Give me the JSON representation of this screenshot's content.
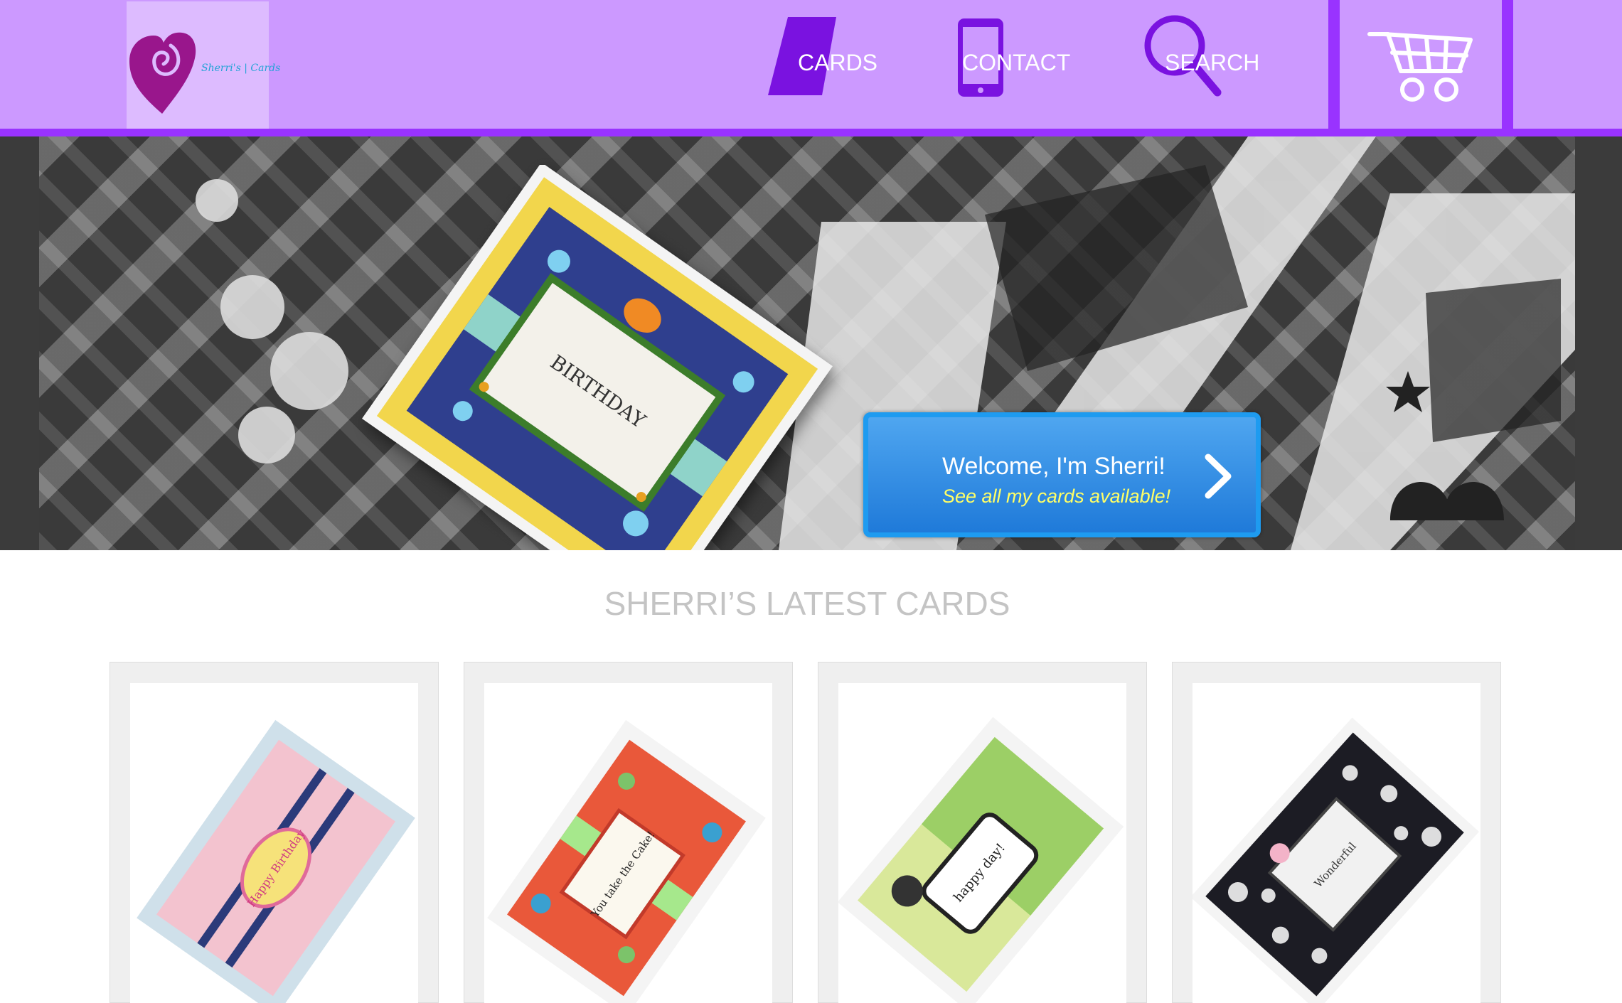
{
  "colors": {
    "header_bg": "#cc99ff",
    "header_accent": "#9933ff",
    "logo_bg": "#ddbbff",
    "welcome_btn": "#2a86e0",
    "welcome_sub": "#ffff66",
    "section_title": "#c4c4c4"
  },
  "logo": {
    "text": "Sherri's | Cards",
    "icon": "heart-swirl-icon"
  },
  "nav": {
    "items": [
      {
        "label": "CARDS",
        "icon": "card-icon"
      },
      {
        "label": "CONTACT",
        "icon": "phone-icon"
      },
      {
        "label": "SEARCH",
        "icon": "search-icon"
      }
    ],
    "cart_icon": "shopping-cart-icon"
  },
  "hero": {
    "card_label": "BIRTHDAY",
    "welcome_title": "Welcome, I'm Sherri!",
    "welcome_subtitle": "See all my cards available!",
    "chevron_icon": "chevron-right-icon"
  },
  "latest": {
    "title": "SHERRI’S LATEST CARDS",
    "products": [
      {
        "photo_text": "Happy Birthday"
      },
      {
        "photo_text": "You take the Cake!"
      },
      {
        "photo_text": "happy day!"
      },
      {
        "photo_text": "Wonderful"
      }
    ]
  }
}
